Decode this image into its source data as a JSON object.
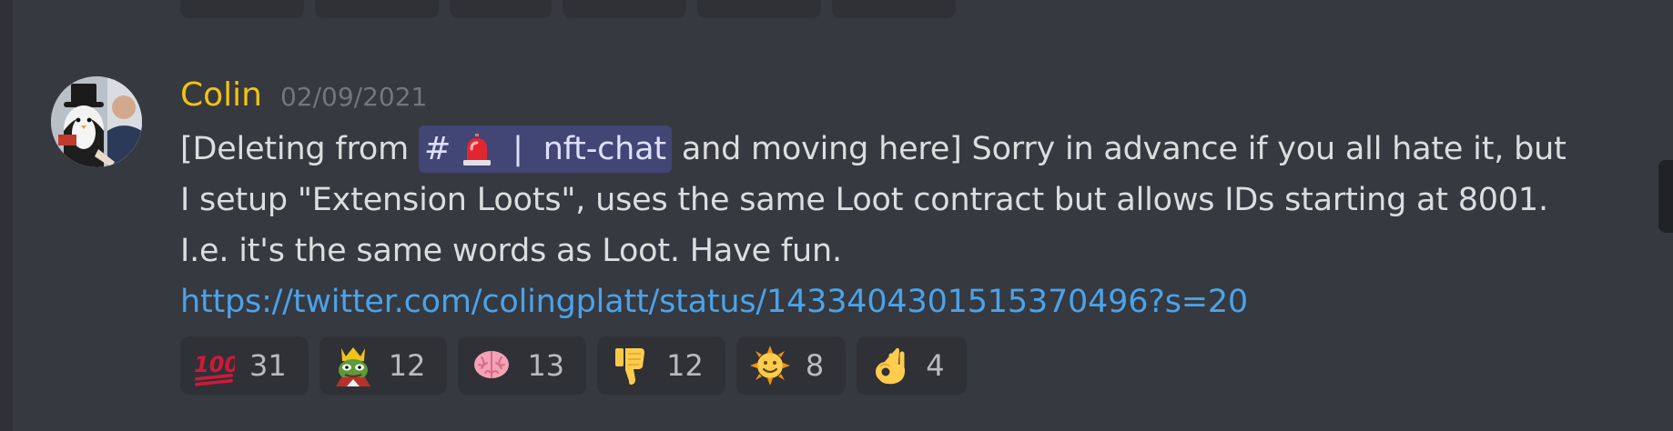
{
  "message": {
    "username": "Colin",
    "username_color": "#f1c40f",
    "timestamp": "02/09/2021",
    "text_before": "[Deleting from ",
    "channel_mention": {
      "hash": "#",
      "separator": "|",
      "name": "nft-chat"
    },
    "text_after": " and moving here] Sorry in advance if you all hate it, but I setup \"Extension Loots\", uses the same Loot contract but allows IDs starting at 8001. I.e. it's the same words as Loot. Have fun.",
    "link": "https://twitter.com/colingplatt/status/1433404301515370496?s=20",
    "reactions": [
      {
        "emoji": "hundred-points-icon",
        "count": "31"
      },
      {
        "emoji": "pepe-king-icon",
        "count": "12"
      },
      {
        "emoji": "brain-icon",
        "count": "13"
      },
      {
        "emoji": "thumbs-down-icon",
        "count": "12"
      },
      {
        "emoji": "sun-face-icon",
        "count": "8"
      },
      {
        "emoji": "ok-hand-icon",
        "count": "4"
      }
    ]
  },
  "colors": {
    "background": "#36393f",
    "reaction_bg": "#2f3136",
    "mention_bg": "#414675",
    "link": "#4aa3ea"
  }
}
